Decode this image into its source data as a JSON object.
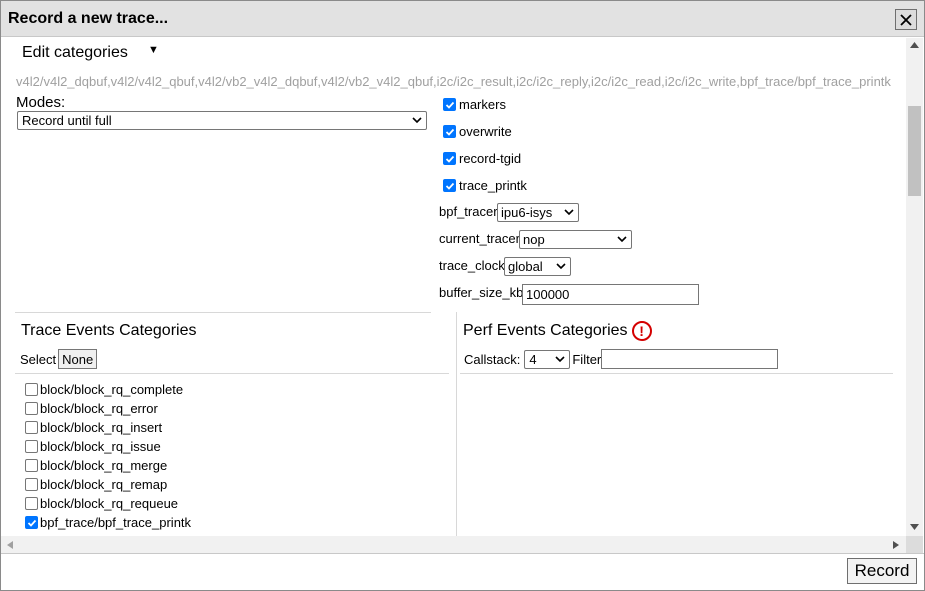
{
  "dialog": {
    "title": "Record a new trace...",
    "close_label": "×"
  },
  "edit_categories": {
    "label": "Edit categories",
    "arrow": "▼"
  },
  "categories_string": "v4l2/v4l2_dqbuf,v4l2/v4l2_qbuf,v4l2/vb2_v4l2_dqbuf,v4l2/vb2_v4l2_qbuf,i2c/i2c_result,i2c/i2c_reply,i2c/i2c_read,i2c/i2c_write,bpf_trace/bpf_trace_printk",
  "modes": {
    "label": "Modes:",
    "selected": "Record until full"
  },
  "options": [
    {
      "label": "markers",
      "checked": true
    },
    {
      "label": "overwrite",
      "checked": true
    },
    {
      "label": "record-tgid",
      "checked": true
    },
    {
      "label": "trace_printk",
      "checked": true
    }
  ],
  "fields": {
    "bpf_tracer": {
      "label": "bpf_tracer",
      "value": "ipu6-isys"
    },
    "current_tracer": {
      "label": "current_tracer",
      "value": "nop"
    },
    "trace_clock": {
      "label": "trace_clock",
      "value": "global"
    },
    "buffer_size_kb": {
      "label": "buffer_size_kb",
      "value": "100000"
    }
  },
  "trace_events": {
    "title": "Trace Events Categories",
    "select_label": "Select",
    "none_label": "None",
    "items": [
      {
        "label": "block/block_rq_complete",
        "checked": false
      },
      {
        "label": "block/block_rq_error",
        "checked": false
      },
      {
        "label": "block/block_rq_insert",
        "checked": false
      },
      {
        "label": "block/block_rq_issue",
        "checked": false
      },
      {
        "label": "block/block_rq_merge",
        "checked": false
      },
      {
        "label": "block/block_rq_remap",
        "checked": false
      },
      {
        "label": "block/block_rq_requeue",
        "checked": false
      },
      {
        "label": "bpf_trace/bpf_trace_printk",
        "checked": true
      }
    ]
  },
  "perf_events": {
    "title": "Perf Events Categories",
    "warning_glyph": "!",
    "callstack_label": "Callstack:",
    "callstack_value": "4",
    "filter_label": "Filter",
    "filter_value": ""
  },
  "footer": {
    "record_label": "Record"
  },
  "colors": {
    "checkbox_on": "#0075ff",
    "warning": "#d40000",
    "titlebar": "#e2e2e2"
  }
}
